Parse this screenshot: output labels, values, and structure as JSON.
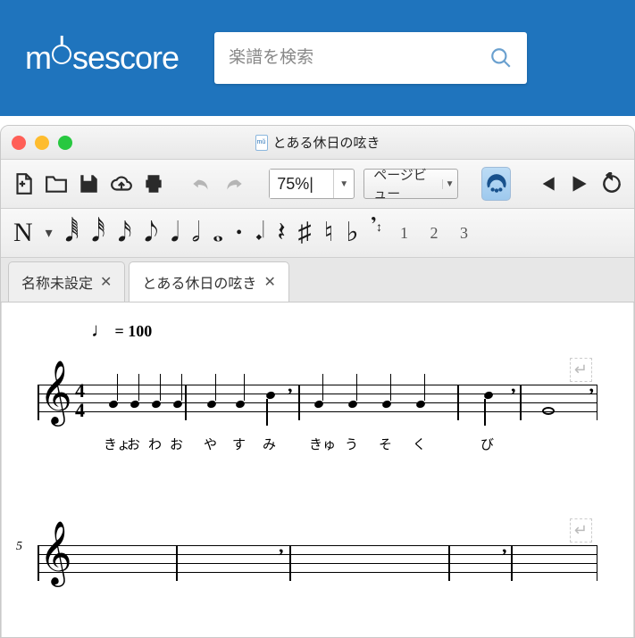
{
  "site": {
    "logo_pre": "m",
    "logo_post": "sescore",
    "search_placeholder": "楽譜を検索"
  },
  "window": {
    "title": "とある休日の呟き"
  },
  "toolbar": {
    "zoom": "75%|",
    "view_mode": "ページビュー"
  },
  "tabs": [
    {
      "label": "名称未設定",
      "active": false
    },
    {
      "label": "とある休日の呟き",
      "active": true
    }
  ],
  "score": {
    "tempo_value": "= 100",
    "time_sig_top": "4",
    "time_sig_bot": "4",
    "measure2_start_num": "5",
    "lyrics_line1": [
      "きょ",
      "お",
      "わ",
      "お",
      "や",
      "す",
      "み",
      "きゅ",
      "う",
      "そ",
      "く",
      "び"
    ],
    "note_tool_123": "1  2  3"
  }
}
